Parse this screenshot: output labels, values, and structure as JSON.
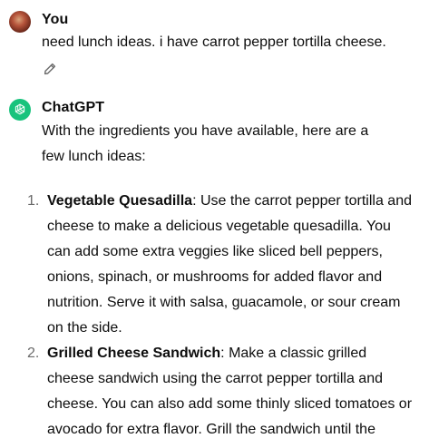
{
  "user_message": {
    "author": "You",
    "text": "need lunch ideas. i have carrot pepper tortilla cheese.",
    "edit_icon": "pencil-icon"
  },
  "assistant_message": {
    "author": "ChatGPT",
    "intro": "With the ingredients you have available, here are a few lunch ideas:",
    "avatar_color": "#19c37d",
    "items": [
      {
        "number": "1.",
        "title": "Vegetable Quesadilla",
        "body": ": Use the carrot pepper tortilla and cheese to make a delicious vegetable quesadilla. You can add some extra veggies like sliced bell peppers, onions, spinach, or mushrooms for added flavor and nutrition. Serve it with salsa, guacamole, or sour cream on the side."
      },
      {
        "number": "2.",
        "title": "Grilled Cheese Sandwich",
        "body": ": Make a classic grilled cheese sandwich using the carrot pepper tortilla and cheese. You can also add some thinly sliced tomatoes or avocado for extra flavor. Grill the sandwich until the tortilla is crispy and the cheese is melted."
      }
    ]
  }
}
